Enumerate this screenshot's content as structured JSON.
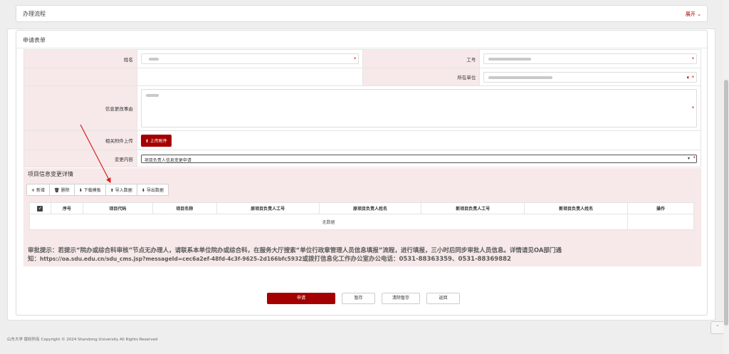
{
  "flow_panel": {
    "title": "办理流程",
    "expand_label": "展开"
  },
  "form": {
    "title": "申请表单",
    "fields": {
      "name_label": "姓名",
      "work_id_label": "工号",
      "unit_label": "所在单位",
      "reason_label": "信息更改事由",
      "attachment_label": "相关附件上传",
      "upload_button": "上传附件",
      "change_label": "变更内容",
      "change_value": "项目负责人信息变更申请"
    },
    "required_mark": "*"
  },
  "detail": {
    "title": "项目信息变更详情",
    "toolbar": {
      "add": "新增",
      "delete": "删除",
      "download_template": "下载模板",
      "import": "导入数据",
      "export": "导出数据"
    },
    "columns": [
      "序号",
      "项目代码",
      "项目名称",
      "原项目负责人工号",
      "原项目负责人姓名",
      "新项目负责人工号",
      "新项目负责人姓名",
      "操作"
    ],
    "empty_text": "无数据"
  },
  "notice": {
    "line1": "审批提示：若提示“院办或综合科审核”节点无办理人，请联系本单位院办或综合科，在服务大厅搜索“单位行政章管理人员信息填报”流程，进行填报，三小时后同步审批人员信息。详情请见OA部门通",
    "line2_prefix": "知：",
    "url": "https://oa.sdu.edu.cn/sdu_cms.jsp?messageId=cec6a2ef-48fd-4c3f-9625-2d166bfc5932",
    "line2_suffix": "或拨打信息化工作办公室办公电话：0531-88363359、0531-88369882"
  },
  "actions": {
    "submit": "申请",
    "save": "暂存",
    "clear": "清除暂存",
    "back": "返回"
  },
  "footer": {
    "copyright": "山东大学 版权所有 Copyright © 2024 Shandong University All Rights Reserved"
  },
  "colors": {
    "accent": "#a50000",
    "label_bg": "#f7e9e9"
  }
}
